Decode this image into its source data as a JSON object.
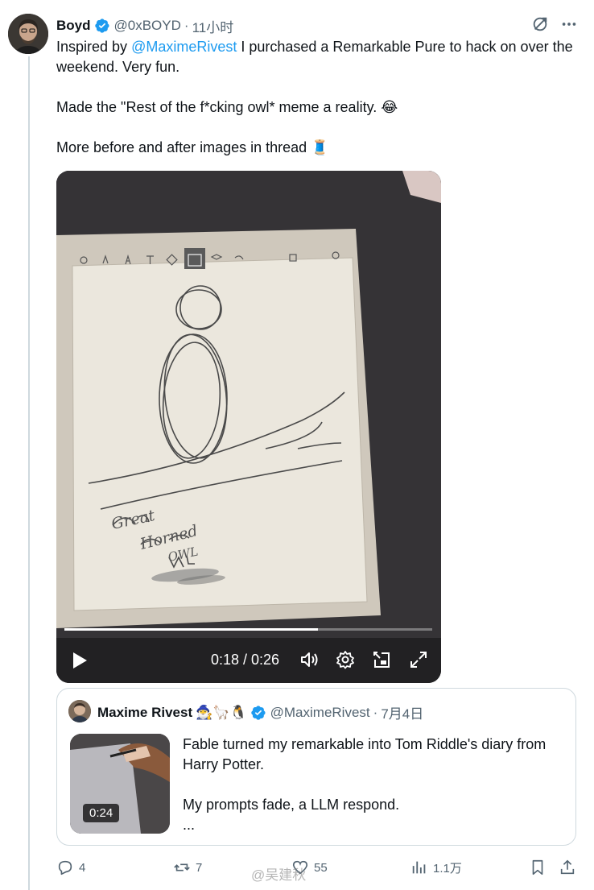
{
  "tweet": {
    "author_name": "Boyd",
    "author_handle": "@0xBOYD",
    "separator": "·",
    "time": "11小时",
    "text_line1_before": "Inspired by ",
    "text_line1_mention": "@MaximeRivest",
    "text_line1_after": " I purchased a Remarkable Pure to hack on over the weekend. Very fun.",
    "text_line2": "Made the \"Rest of the f*cking owl* meme a reality. 😂",
    "text_line3": "More before and after images in thread 🧵"
  },
  "video": {
    "elapsed": "0:18",
    "duration": "0:26",
    "time_display": "0:18 / 0:26",
    "progress_fraction": 0.69,
    "drawing_caption": [
      "Great",
      "Horned",
      "OWL"
    ]
  },
  "quote": {
    "author_name": "Maxime Rivest",
    "author_emojis": "🧙‍♂️🦙🐧",
    "author_handle": "@MaximeRivest",
    "separator": "·",
    "date": "7月4日",
    "text_line1": "Fable turned my remarkable into Tom Riddle's diary from Harry Potter.",
    "text_line2": "My prompts fade, a LLM respond.",
    "text_more": "...",
    "thumb_duration": "0:24"
  },
  "actions": {
    "replies": "4",
    "reposts": "7",
    "likes": "55",
    "views": "1.1万"
  },
  "watermark": "@吴建秋",
  "colors": {
    "accent": "#1d9bf0",
    "text": "#0f1419",
    "secondary": "#536471",
    "border": "#cfd9de"
  },
  "icons": [
    "verified-badge-icon",
    "grok-icon",
    "more-icon",
    "play-icon",
    "volume-icon",
    "settings-icon",
    "pip-icon",
    "fullscreen-icon",
    "reply-icon",
    "repost-icon",
    "like-icon",
    "views-icon",
    "bookmark-icon",
    "share-icon"
  ]
}
